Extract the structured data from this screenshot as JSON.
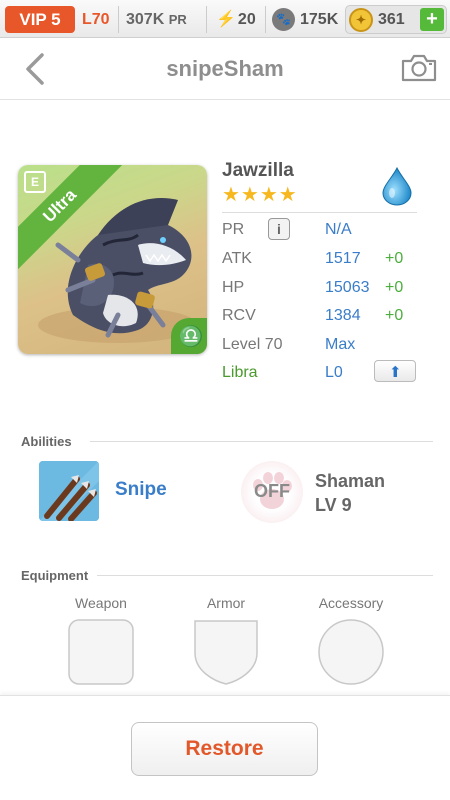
{
  "topbar": {
    "vip": "VIP 5",
    "level": "L70",
    "pr_value": "307K",
    "pr_unit": "PR",
    "energy": "20",
    "paws": "175K",
    "coins": "361",
    "add": "+"
  },
  "header": {
    "title": "snipeSham"
  },
  "monster": {
    "name": "Jawzilla",
    "rarity": "Ultra",
    "stars": "★★★★",
    "element_icon": "water-drop-icon",
    "sign_symbol": "♎",
    "stats": [
      {
        "label": "PR",
        "value": "N/A",
        "bonus": ""
      },
      {
        "label": "ATK",
        "value": "1517",
        "bonus": "+0"
      },
      {
        "label": "HP",
        "value": "15063",
        "bonus": "+0"
      },
      {
        "label": "RCV",
        "value": "1384",
        "bonus": "+0"
      },
      {
        "label": "Level 70",
        "value": "Max",
        "bonus": ""
      },
      {
        "label": "Libra",
        "value": "L0",
        "bonus": ""
      }
    ],
    "info_glyph": "i",
    "upgrade_glyph": "⬆"
  },
  "abilities": {
    "title": "Abilities",
    "primary_name": "Snipe",
    "secondary_state": "OFF",
    "secondary_name": "Shaman",
    "secondary_level": "LV 9"
  },
  "equipment": {
    "title": "Equipment",
    "slots": [
      "Weapon",
      "Armor",
      "Accessory"
    ]
  },
  "footer": {
    "restore_label": "Restore"
  },
  "colors": {
    "accent_orange": "#e8572a",
    "link_blue": "#3a7dc9",
    "bonus_green": "#4cae3d",
    "star_gold": "#f6b81e",
    "rarity_green": "#63b33f"
  }
}
